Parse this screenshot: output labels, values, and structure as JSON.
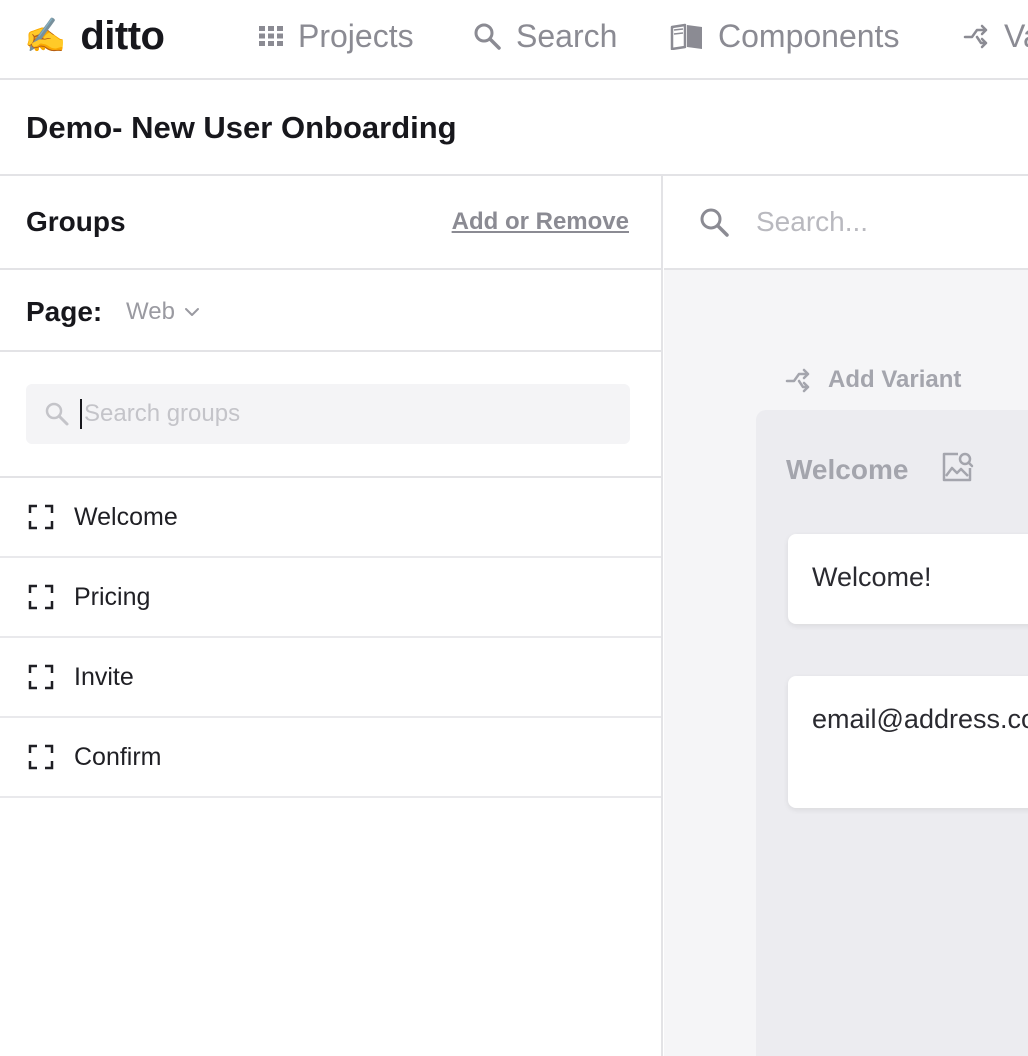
{
  "app": {
    "logo_emoji": "✍️",
    "logo_text": "ditto"
  },
  "topnav": {
    "items": [
      {
        "label": "Projects",
        "icon": "grid-icon"
      },
      {
        "label": "Search",
        "icon": "search-icon"
      },
      {
        "label": "Components",
        "icon": "book-icon"
      },
      {
        "label": "Va",
        "icon": "variant-icon"
      }
    ]
  },
  "project": {
    "title": "Demo- New User Onboarding"
  },
  "groups_panel": {
    "title": "Groups",
    "add_remove_label": "Add or Remove",
    "page_label": "Page:",
    "page_value": "Web",
    "search_placeholder": "Search groups",
    "items": [
      {
        "label": "Welcome",
        "icon": "frame-icon"
      },
      {
        "label": "Pricing",
        "icon": "frame-icon"
      },
      {
        "label": "Invite",
        "icon": "frame-icon"
      },
      {
        "label": "Confirm",
        "icon": "frame-icon"
      }
    ]
  },
  "canvas": {
    "search_placeholder": "Search...",
    "add_variant_label": "Add Variant",
    "group": {
      "title": "Welcome",
      "icon": "image-search-icon",
      "texts": [
        "Welcome!",
        "email@address.com"
      ]
    }
  },
  "colors": {
    "muted": "#8b8b93",
    "border": "#e3e3e6",
    "canvas_bg": "#f5f5f7",
    "card_bg": "#ececf0"
  }
}
